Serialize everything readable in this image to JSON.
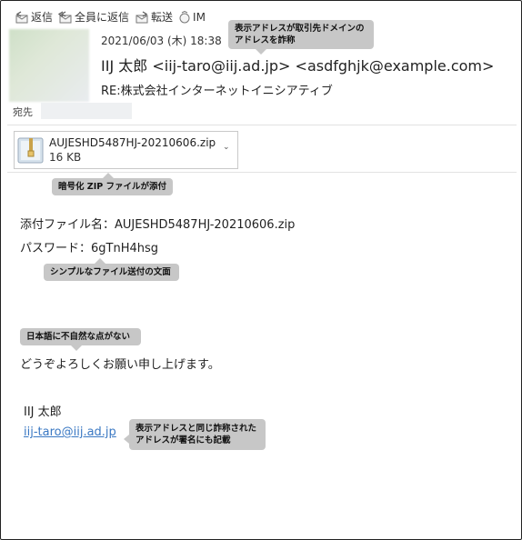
{
  "toolbar": {
    "reply": "返信",
    "reply_all": "全員に返信",
    "forward": "転送",
    "im": "IM"
  },
  "header": {
    "date": "2021/06/03 (木) 18:38",
    "sender_name": "IIJ 太郎",
    "sender_addr": "<iij-taro@iij.ad.jp>",
    "reply_addr": "<asdfghjk@example.com>",
    "subject": "RE:株式会社インターネットイニシアティブ",
    "to_label": "宛先"
  },
  "attachment": {
    "filename": "AUJESHD5487HJ-20210606.zip",
    "size": "16 KB"
  },
  "body": {
    "line1": "添付ファイル名：AUJESHD5487HJ-20210606.zip",
    "line2": "パスワード：6gTnH4hsg",
    "line3": "どうぞよろしくお願い申し上げます。",
    "sig_name": "IIJ 太郎",
    "sig_email": "iij-taro@iij.ad.jp"
  },
  "callouts": {
    "display_address_line1": "表示アドレスが取引先ドメインの",
    "display_address_line2": "アドレスを詐称",
    "encrypted_zip": "暗号化 ZIP ファイルが添付",
    "simple_text": "シンプルなファイル送付の文面",
    "natural_japanese": "日本語に不自然な点がない",
    "signature_line1": "表示アドレスと同じ詐称された",
    "signature_line2": "アドレスが署名にも記載"
  },
  "colors": {
    "link": "#3a78c3",
    "callout_bg": "#c7c7c7"
  }
}
